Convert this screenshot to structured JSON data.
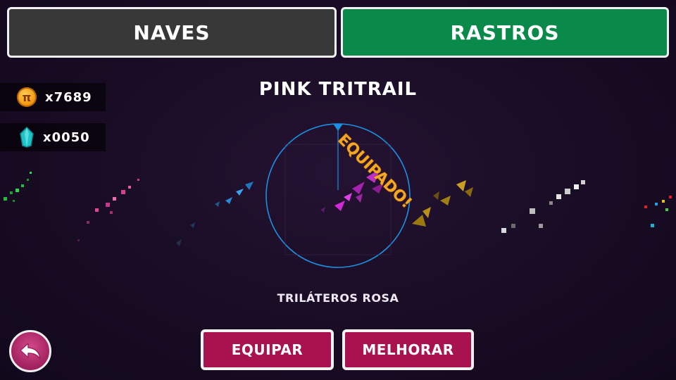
{
  "tabs": [
    {
      "label": "NAVES",
      "active": false,
      "color": "#383838"
    },
    {
      "label": "RASTROS",
      "active": true,
      "color": "#0a8a4a"
    }
  ],
  "currency": {
    "coins": {
      "icon": "coin-icon",
      "value": "x7689"
    },
    "gems": {
      "icon": "gem-icon",
      "value": "x0050"
    }
  },
  "item": {
    "name": "PINK TRITRAIL",
    "status": "EQUIPADO!",
    "description": "TRILÁTEROS ROSA"
  },
  "buttons": {
    "equip": "EQUIPAR",
    "upgrade": "MELHORAR",
    "back_icon": "back-arrow-icon"
  },
  "colors": {
    "accent_button": "#a8124e",
    "status": "#f5a623",
    "ring": "#1e8fe0"
  }
}
